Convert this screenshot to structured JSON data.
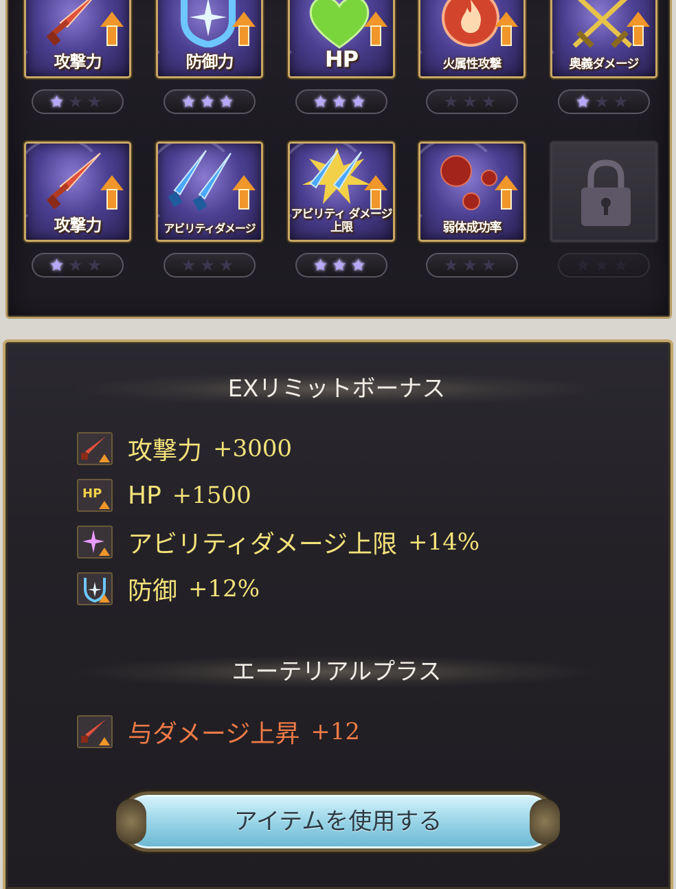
{
  "grid": {
    "slots": [
      {
        "label": "攻撃力",
        "stars": 1,
        "symbol": "sword-icon",
        "color": "#e0503a"
      },
      {
        "label": "防御力",
        "stars": 3,
        "symbol": "shield-icon",
        "color": "#5fb8ff"
      },
      {
        "label": "HP",
        "stars": 3,
        "symbol": "heart-icon",
        "color": "#7ad43c"
      },
      {
        "label": "火属性攻撃",
        "stars": 0,
        "symbol": "fire-icon",
        "color": "#e0503a"
      },
      {
        "label": "奥義ダメージ",
        "stars": 1,
        "symbol": "crossed-swords-icon",
        "color": "#e8c34a"
      },
      {
        "label": "攻撃力",
        "stars": 1,
        "symbol": "sword-icon",
        "color": "#e0503a"
      },
      {
        "label": "アビリティダメージ",
        "stars": 0,
        "symbol": "twin-swords-icon",
        "color": "#4aa8ff"
      },
      {
        "label": "アビリティ ダメージ上限",
        "stars": 3,
        "symbol": "twin-swords-burst-icon",
        "color": "#4aa8ff"
      },
      {
        "label": "弱体成功率",
        "stars": 0,
        "symbol": "debuff-orbs-icon",
        "color": "#c0392b"
      },
      {
        "label": "",
        "stars": 0,
        "symbol": "lock-icon",
        "locked": true
      }
    ]
  },
  "ex_bonus": {
    "title": "EXリミットボーナス",
    "items": [
      {
        "icon": "sword-icon",
        "label": "攻撃力",
        "value": "+3000"
      },
      {
        "icon": "hp-icon",
        "icon_text": "HP",
        "label": "HP",
        "value": "+1500"
      },
      {
        "icon": "sparkle-icon",
        "label": "アビリティダメージ上限",
        "value": "+14%"
      },
      {
        "icon": "shield-icon",
        "label": "防御",
        "value": "+12%"
      }
    ]
  },
  "ethereal": {
    "title": "エーテリアルプラス",
    "items": [
      {
        "icon": "sword-icon",
        "label": "与ダメージ上昇",
        "value": "+12"
      }
    ]
  },
  "use_button": {
    "label": "アイテムを使用する"
  }
}
